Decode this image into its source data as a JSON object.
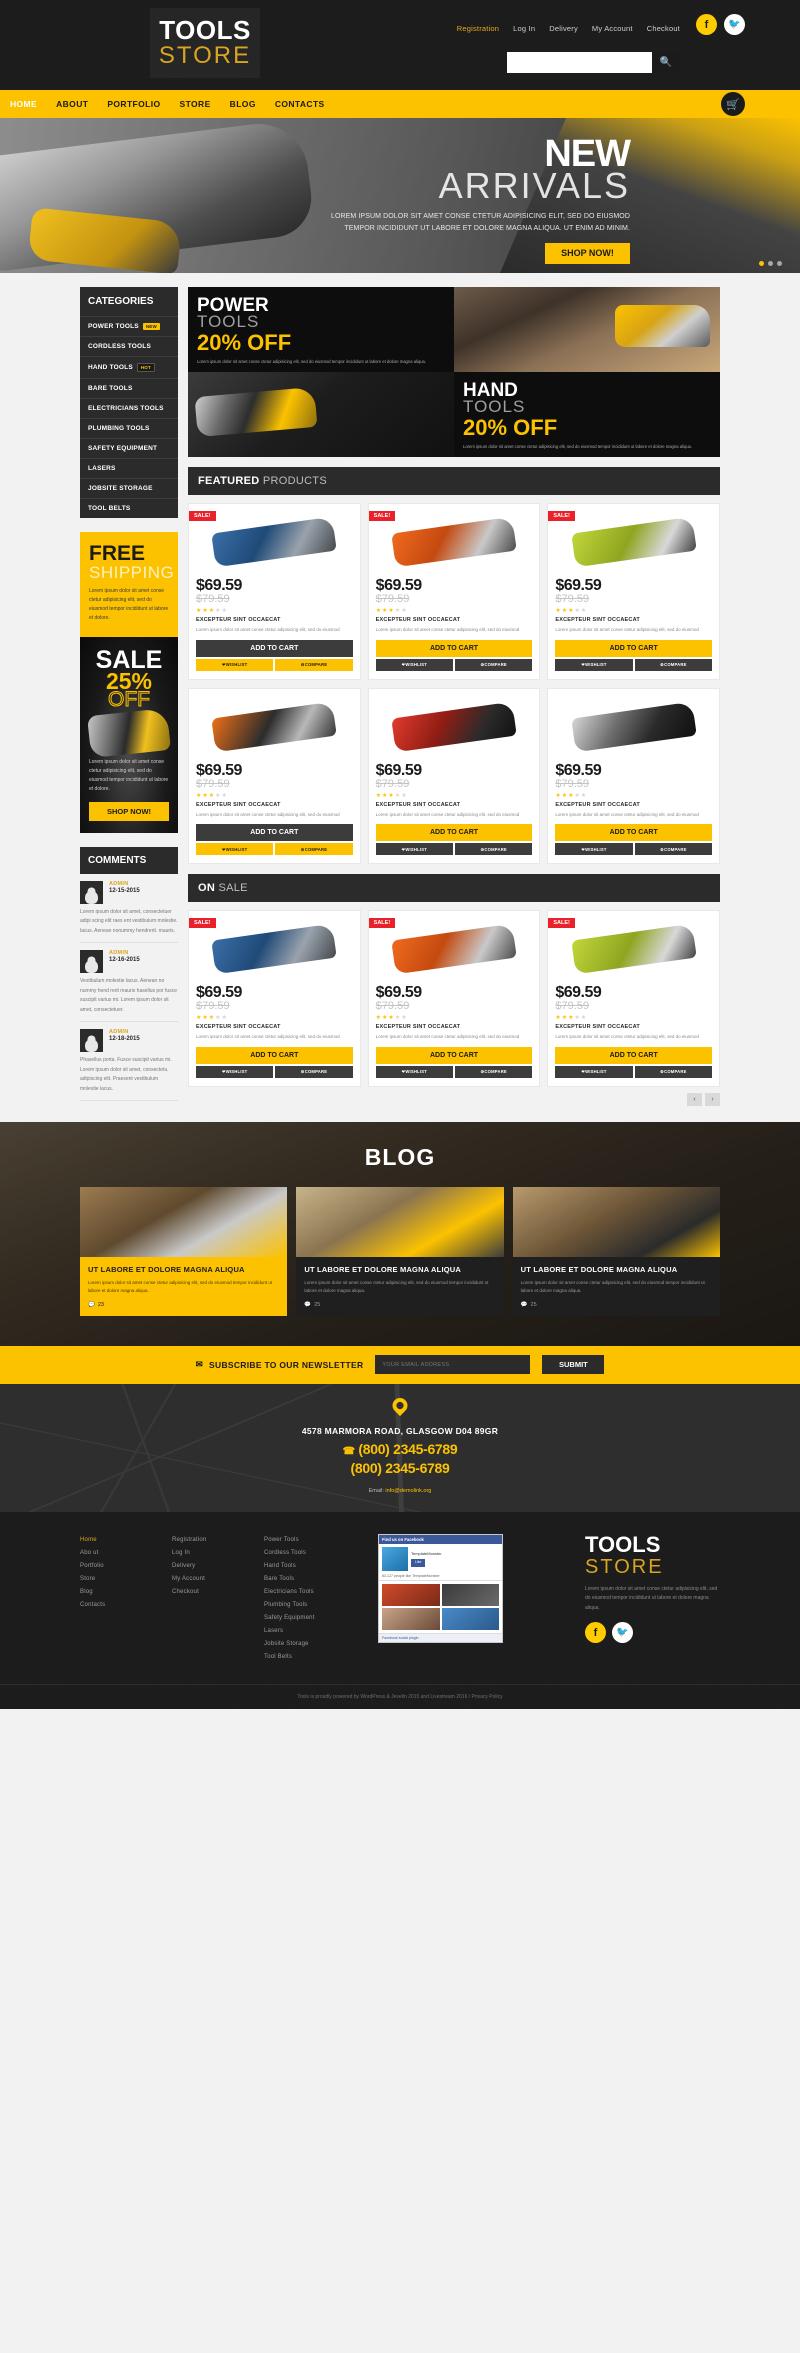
{
  "header": {
    "logo_top": "TOOLS",
    "logo_bottom": "STORE",
    "top_links": [
      {
        "label": "Registration",
        "highlight": true
      },
      {
        "label": "Log In",
        "highlight": false
      },
      {
        "label": "Delivery",
        "highlight": false
      },
      {
        "label": "My Account",
        "highlight": false
      },
      {
        "label": "Checkout",
        "highlight": false
      }
    ],
    "social": [
      {
        "name": "facebook-icon",
        "glyph": "f"
      },
      {
        "name": "twitter-icon",
        "glyph": "ᴠ"
      }
    ],
    "search_placeholder": "",
    "search_value": "",
    "search_icon": "search-icon"
  },
  "nav": {
    "items": [
      {
        "label": "HOME",
        "active": true
      },
      {
        "label": "ABOUT",
        "active": false
      },
      {
        "label": "PORTFOLIO",
        "active": false
      },
      {
        "label": "STORE",
        "active": false
      },
      {
        "label": "BLOG",
        "active": false
      },
      {
        "label": "CONTACTS",
        "active": false
      }
    ],
    "cart_icon": "shopping-cart-icon"
  },
  "hero": {
    "title_line1": "NEW",
    "title_line2": "ARRIVALS",
    "paragraph": "LOREM IPSUM DOLOR SIT AMET CONSE CTETUR ADIPISICING ELIT, SED DO EIUSMOD TEMPOR INCIDIDUNT UT LABORE ET DOLORE MAGNA ALIQUA. UT ENIM AD MINIM.",
    "button": "SHOP NOW!",
    "slides": 3,
    "active_slide": 1
  },
  "sidebar": {
    "categories_title": "CATEGORIES",
    "categories": [
      {
        "label": "POWER TOOLS",
        "tag": "NEW",
        "tag_type": "new"
      },
      {
        "label": "CORDLESS TOOLS",
        "tag": "",
        "tag_type": ""
      },
      {
        "label": "HAND TOOLS",
        "tag": "HOT",
        "tag_type": "hot"
      },
      {
        "label": "BARE TOOLS",
        "tag": "",
        "tag_type": ""
      },
      {
        "label": "ELECTRICIANS TOOLS",
        "tag": "",
        "tag_type": ""
      },
      {
        "label": "PLUMBING TOOLS",
        "tag": "",
        "tag_type": ""
      },
      {
        "label": "SAFETY EQUIPMENT",
        "tag": "",
        "tag_type": ""
      },
      {
        "label": "LASERS",
        "tag": "",
        "tag_type": ""
      },
      {
        "label": "JOBSITE STORAGE",
        "tag": "",
        "tag_type": ""
      },
      {
        "label": "TOOL BELTS",
        "tag": "",
        "tag_type": ""
      }
    ],
    "free_shipping": {
      "line1": "FREE",
      "line2": "SHIPPING",
      "text": "Lorem ipsum dolor sit amet conse ctetur adipisicing elit, sed do eiusmod tempor incididunt ut labore et dolore."
    },
    "sale": {
      "line1": "SALE",
      "line2": "25%",
      "line3": "OFF",
      "text": "Lorem ipsum dolor sit amet conse ctetur adipisicing elit, sed do eiusmod tempor incididunt ut labore et dolore.",
      "button": "SHOP NOW!"
    },
    "comments_title": "COMMENTS",
    "comments": [
      {
        "author": "ADMIN",
        "date": "12-15-2015",
        "text": "Lorem ipsum dolor sit amet, consectetuer adipi scing elit raes ent vestibulum molestie. lacus. Aenean nonummy hendrerit. mauris."
      },
      {
        "author": "ADMIN",
        "date": "12-16-2015",
        "text": "Vestibulum molestie lacus. Aenean no nummy hend rerit mauris hasellus por fusce suscipit varius mi. Lorem ipsum dolor sit amet, consectetuer."
      },
      {
        "author": "ADMIN",
        "date": "12-18-2015",
        "text": "Phasellus porta. Fusce suscipit varius mi. Lorem ipsum dolor sit amet, consectetu. adipiscing elit. Praesent vestibulum molestie lacus."
      }
    ]
  },
  "promos": [
    {
      "title1": "POWER",
      "title2": "TOOLS",
      "title3": "20% OFF",
      "text": "Lorem ipsum dolor sit amet conse ctetur adipisicing elit, sed do eiusmod tempor incididunt ut labore et dolore magna aliqua."
    },
    {
      "title1": "HAND",
      "title2": "TOOLS",
      "title3": "20% OFF",
      "text": "Lorem ipsum dolor sit amet conse ctetur adipisicing elit, sed do eiusmod tempor incididunt ut labore et dolore magna aliqua."
    }
  ],
  "featured": {
    "heading_bold": "FEATURED",
    "heading_light": " PRODUCTS",
    "products": [
      {
        "badge": "SALE!",
        "price": "$69.59",
        "old_price": "$79.59",
        "rating": 3,
        "title": "EXCEPTEUR SINT OCCAECAT",
        "desc": "Lorem ipsum dolor sit amet conse ctetur adipisicing elit, sed do eiusmod",
        "cart": "ADD TO CART",
        "cart_style": "dark",
        "wishlist": "WISHLIST",
        "compare": "COMPARE",
        "tool": "t-jigsaw"
      },
      {
        "badge": "SALE!",
        "price": "$69.59",
        "old_price": "$79.59",
        "rating": 3,
        "title": "EXCEPTEUR SINT OCCAECAT",
        "desc": "Lorem ipsum dolor sit amet conse ctetur adipisicing elit, sed do eiusmod",
        "cart": "ADD TO CART",
        "cart_style": "gold",
        "wishlist": "WISHLIST",
        "compare": "COMPARE",
        "tool": "t-router"
      },
      {
        "badge": "SALE!",
        "price": "$69.59",
        "old_price": "$79.59",
        "rating": 3,
        "title": "EXCEPTEUR SINT OCCAECAT",
        "desc": "Lorem ipsum dolor sit amet conse ctetur adipisicing elit, sed do eiusmod",
        "cart": "ADD TO CART",
        "cart_style": "gold",
        "wishlist": "WISHLIST",
        "compare": "COMPARE",
        "tool": "t-sander"
      },
      {
        "badge": "",
        "price": "$69.59",
        "old_price": "$79.59",
        "rating": 3,
        "title": "EXCEPTEUR SINT OCCAECAT",
        "desc": "Lorem ipsum dolor sit amet conse ctetur adipisicing elit, sed do eiusmod",
        "cart": "ADD TO CART",
        "cart_style": "dark",
        "wishlist": "WISHLIST",
        "compare": "COMPARE",
        "tool": "t-hammer"
      },
      {
        "badge": "",
        "price": "$69.59",
        "old_price": "$79.59",
        "rating": 3,
        "title": "EXCEPTEUR SINT OCCAECAT",
        "desc": "Lorem ipsum dolor sit amet conse ctetur adipisicing elit, sed do eiusmod",
        "cart": "ADD TO CART",
        "cart_style": "gold",
        "wishlist": "WISHLIST",
        "compare": "COMPARE",
        "tool": "t-drill"
      },
      {
        "badge": "",
        "price": "$69.59",
        "old_price": "$79.59",
        "rating": 3,
        "title": "EXCEPTEUR SINT OCCAECAT",
        "desc": "Lorem ipsum dolor sit amet conse ctetur adipisicing elit, sed do eiusmod",
        "cart": "ADD TO CART",
        "cart_style": "gold",
        "wishlist": "WISHLIST",
        "compare": "COMPARE",
        "tool": "t-grind"
      }
    ]
  },
  "onsale": {
    "heading_bold": "ON",
    "heading_light": " SALE",
    "products": [
      {
        "badge": "SALE!",
        "price": "$69.59",
        "old_price": "$79.59",
        "rating": 3,
        "title": "EXCEPTEUR SINT OCCAECAT",
        "desc": "Lorem ipsum dolor sit amet conse ctetur adipisicing elit, sed do eiusmod",
        "cart": "ADD TO CART",
        "cart_style": "gold",
        "wishlist": "WISHLIST",
        "compare": "COMPARE",
        "tool": "t-jigsaw"
      },
      {
        "badge": "SALE!",
        "price": "$69.59",
        "old_price": "$79.59",
        "rating": 3,
        "title": "EXCEPTEUR SINT OCCAECAT",
        "desc": "Lorem ipsum dolor sit amet conse ctetur adipisicing elit, sed do eiusmod",
        "cart": "ADD TO CART",
        "cart_style": "gold",
        "wishlist": "WISHLIST",
        "compare": "COMPARE",
        "tool": "t-router"
      },
      {
        "badge": "SALE!",
        "price": "$69.59",
        "old_price": "$79.59",
        "rating": 3,
        "title": "EXCEPTEUR SINT OCCAECAT",
        "desc": "Lorem ipsum dolor sit amet conse ctetur adipisicing elit, sed do eiusmod",
        "cart": "ADD TO CART",
        "cart_style": "gold",
        "wishlist": "WISHLIST",
        "compare": "COMPARE",
        "tool": "t-sander"
      }
    ],
    "prev": "‹",
    "next": "›"
  },
  "blog": {
    "heading": "BLOG",
    "posts": [
      {
        "title": "UT LABORE ET DOLORE MAGNA ALIQUA",
        "text": "Lorem ipsum dolor sit amet conse ctetur adipisicing elit, sed do eiusmod tempor incididunt ut labore et dolore magna aliqua.",
        "comments": "23",
        "style": "gold"
      },
      {
        "title": "UT LABORE ET DOLORE MAGNA ALIQUA",
        "text": "Lorem ipsum dolor sit amet conse ctetur adipisicing elit, sed do eiusmod tempor incididunt ut labore et dolore magna aliqua.",
        "comments": "25",
        "style": "dk"
      },
      {
        "title": "UT LABORE ET DOLORE MAGNA ALIQUA",
        "text": "Lorem ipsum dolor sit amet conse ctetur adipisicing elit, sed do eiusmod tempor incididunt ut labore et dolore magna aliqua.",
        "comments": "25",
        "style": "dk"
      }
    ]
  },
  "newsletter": {
    "icon": "envelope-icon",
    "label": "SUBSCRIBE TO OUR NEWSLETTER",
    "placeholder": "YOUR EMAIL ADDRESS",
    "value": "",
    "button": "SUBMIT"
  },
  "contacts": {
    "pin_icon": "map-pin-icon",
    "address": "4578 MARMORA ROAD,  GLASGOW D04 89GR",
    "phone_icon": "phone-icon",
    "phone1": "(800) 2345-6789",
    "phone2": "(800) 2345-6789",
    "email_label": "Email:",
    "email": "info@demolink.org"
  },
  "footer": {
    "col1": [
      {
        "label": "Home",
        "highlight": true
      },
      {
        "label": "Abo  ut",
        "highlight": false
      },
      {
        "label": "Portfolio",
        "highlight": false
      },
      {
        "label": "Store",
        "highlight": false
      },
      {
        "label": "Blog",
        "highlight": false
      },
      {
        "label": "Contacts",
        "highlight": false
      }
    ],
    "col2": [
      {
        "label": "Registration",
        "highlight": false
      },
      {
        "label": "Log In",
        "highlight": false
      },
      {
        "label": "Delivery",
        "highlight": false
      },
      {
        "label": "My Account",
        "highlight": false
      },
      {
        "label": "Checkout",
        "highlight": false
      }
    ],
    "col3": [
      {
        "label": "Power Tools",
        "highlight": false
      },
      {
        "label": "Cordless Tools",
        "highlight": false
      },
      {
        "label": "Hand Tools",
        "highlight": false
      },
      {
        "label": "Bare Tools",
        "highlight": false
      },
      {
        "label": "Electricians Tools",
        "highlight": false
      },
      {
        "label": "Plumbing Tools",
        "highlight": false
      },
      {
        "label": "Safety Equipment",
        "highlight": false
      },
      {
        "label": "Lasers",
        "highlight": false
      },
      {
        "label": "Jobsite Storage",
        "highlight": false
      },
      {
        "label": "Tool Belts",
        "highlight": false
      }
    ],
    "facebook_widget": {
      "header": "Find us on Facebook",
      "page_name": "TemplateMonster",
      "like_button": "Like",
      "count_text": "63,127 people like TemplateMonster",
      "footer": "Facebook social plugin"
    },
    "logo_top": "TOOLS",
    "logo_bottom": "STORE",
    "about": "Lorem ipsum dolor sit amet conse ctetur adipisicing elit, sed do eiusmod tempor incididunt ut labore et dolore magna aliqua.",
    "social": [
      {
        "name": "facebook-icon",
        "glyph": "f"
      },
      {
        "name": "twitter-icon",
        "glyph": "ᴠ"
      }
    ],
    "copyright": "Tools is proudly powered by WordPress & Jevelin 2015 and Livestream 2016 / Privacy Policy"
  }
}
